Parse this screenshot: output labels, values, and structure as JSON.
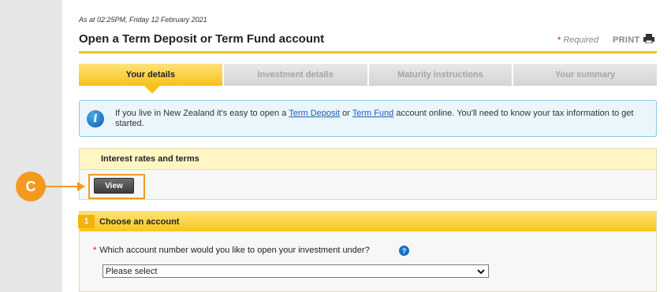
{
  "header": {
    "timestamp": "As at 02:25PM, Friday 12 February 2021",
    "title": "Open a Term Deposit or Term Fund account",
    "required_star": "*",
    "required_label": "Required",
    "print_label": "PRINT",
    "print_icon": "printer-icon"
  },
  "tabs": [
    {
      "label": "Your details",
      "active": true
    },
    {
      "label": "Investment details",
      "active": false
    },
    {
      "label": "Maturity instructions",
      "active": false
    },
    {
      "label": "Your summary",
      "active": false
    }
  ],
  "info": {
    "icon": "info-icon",
    "text_before": "If you live in New Zealand it's easy to open a ",
    "link_term_deposit": "Term Deposit",
    "text_middle": " or ",
    "link_term_fund": "Term Fund",
    "text_after": " account online. You'll need to know your tax information to get started."
  },
  "rates": {
    "heading": "Interest rates and terms",
    "view_button": "View"
  },
  "annotation": {
    "callout_label": "C",
    "color": "#f39a1e"
  },
  "account": {
    "step_number": "1",
    "heading": "Choose an account",
    "required_star": "*",
    "question": "Which account number would you like to open your investment under?",
    "help_icon": "help-icon",
    "select_value": "Please select"
  },
  "colors": {
    "accent": "#f5c21b",
    "info_bg": "#eaf6fc",
    "link": "#1a5fb4"
  }
}
